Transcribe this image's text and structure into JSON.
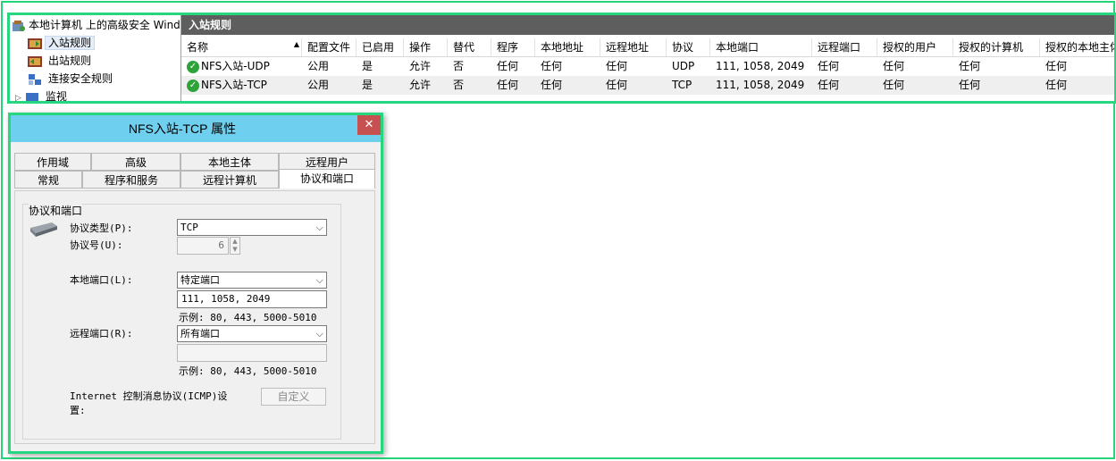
{
  "tree": {
    "root_label": "本地计算机 上的高级安全 Windows",
    "items": [
      {
        "label": "入站规则",
        "selected": true
      },
      {
        "label": "出站规则",
        "selected": false
      },
      {
        "label": "连接安全规则",
        "selected": false
      },
      {
        "label": "监视",
        "selected": false
      }
    ]
  },
  "rules": {
    "title": "入站规则",
    "columns": [
      "名称",
      "配置文件",
      "已启用",
      "操作",
      "替代",
      "程序",
      "本地地址",
      "远程地址",
      "协议",
      "本地端口",
      "远程端口",
      "授权的用户",
      "授权的计算机",
      "授权的本地主体"
    ],
    "rows": [
      [
        "NFS入站-UDP",
        "公用",
        "是",
        "允许",
        "否",
        "任何",
        "任何",
        "任何",
        "UDP",
        "111, 1058, 2049",
        "任何",
        "任何",
        "任何",
        "任何"
      ],
      [
        "NFS入站-TCP",
        "公用",
        "是",
        "允许",
        "否",
        "任何",
        "任何",
        "任何",
        "TCP",
        "111, 1058, 2049",
        "任何",
        "任何",
        "任何",
        "任何"
      ]
    ]
  },
  "dialog": {
    "title": "NFS入站-TCP 属性",
    "close_label": "✕",
    "tabs_row1": [
      "作用域",
      "高级",
      "本地主体",
      "远程用户"
    ],
    "tabs_row2": [
      "常规",
      "程序和服务",
      "远程计算机",
      "协议和端口"
    ],
    "active_tab": "协议和端口",
    "group_label": "协议和端口",
    "protocol_type_label": "协议类型(P):",
    "protocol_type_value": "TCP",
    "protocol_number_label": "协议号(U):",
    "protocol_number_value": "6",
    "local_port_label": "本地端口(L):",
    "local_port_mode": "特定端口",
    "local_port_value": "111, 1058, 2049",
    "local_port_example": "示例: 80, 443, 5000-5010",
    "remote_port_label": "远程端口(R):",
    "remote_port_mode": "所有端口",
    "remote_port_value": "",
    "remote_port_example": "示例: 80, 443, 5000-5010",
    "icmp_label_line1": "Internet 控制消息协议(ICMP)设",
    "icmp_label_line2": "置:",
    "customize_button": "自定义"
  }
}
